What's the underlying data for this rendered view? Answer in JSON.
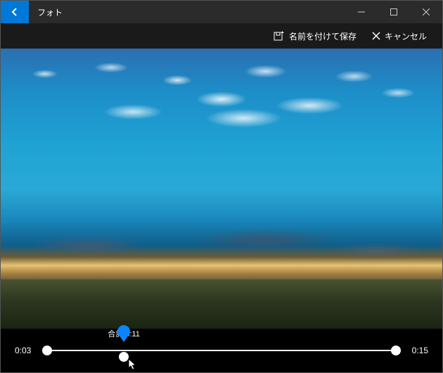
{
  "window": {
    "appTitle": "フォト"
  },
  "toolbar": {
    "saveAs": "名前を付けて保存",
    "cancel": "キャンセル"
  },
  "timeline": {
    "startTime": "0:03",
    "endTime": "0:15",
    "totalPrefix": "合計",
    "totalTime": "0:11",
    "startHandlePercent": 0,
    "endHandlePercent": 100,
    "playheadPercent": 22
  },
  "colors": {
    "accent": "#0a84ff",
    "backButton": "#0078d7"
  }
}
